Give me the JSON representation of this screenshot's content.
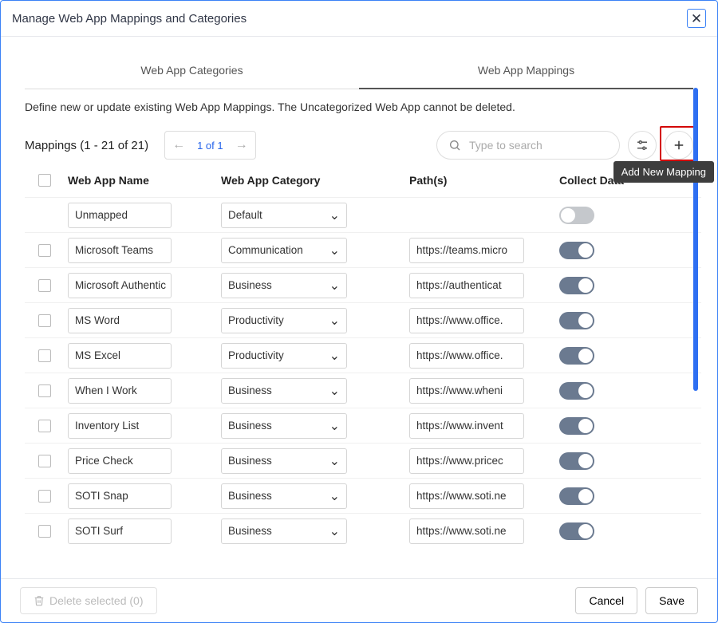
{
  "dialog": {
    "title": "Manage Web App Mappings and Categories",
    "tabs": {
      "categories": "Web App Categories",
      "mappings": "Web App Mappings"
    },
    "description": "Define new or update existing Web App Mappings. The Uncategorized Web App cannot be deleted.",
    "tooltip": "Add New Mapping"
  },
  "toolbar": {
    "count_label": "Mappings (1 - 21 of 21)",
    "page_text": "1 of 1",
    "search_placeholder": "Type to search"
  },
  "columns": {
    "name": "Web App Name",
    "category": "Web App Category",
    "paths": "Path(s)",
    "collect": "Collect Data"
  },
  "rows": [
    {
      "name": "Unmapped",
      "category": "Default",
      "path": "",
      "collect": false,
      "checkable": false
    },
    {
      "name": "Microsoft Teams",
      "category": "Communication",
      "path": "https://teams.micro",
      "collect": true,
      "checkable": true
    },
    {
      "name": "Microsoft Authentic",
      "category": "Business",
      "path": "https://authenticat",
      "collect": true,
      "checkable": true
    },
    {
      "name": "MS Word",
      "category": "Productivity",
      "path": "https://www.office.",
      "collect": true,
      "checkable": true
    },
    {
      "name": "MS Excel",
      "category": "Productivity",
      "path": "https://www.office.",
      "collect": true,
      "checkable": true
    },
    {
      "name": "When I Work",
      "category": "Business",
      "path": "https://www.wheni",
      "collect": true,
      "checkable": true
    },
    {
      "name": "Inventory List",
      "category": "Business",
      "path": "https://www.invent",
      "collect": true,
      "checkable": true
    },
    {
      "name": "Price Check",
      "category": "Business",
      "path": "https://www.pricec",
      "collect": true,
      "checkable": true
    },
    {
      "name": "SOTI Snap",
      "category": "Business",
      "path": "https://www.soti.ne",
      "collect": true,
      "checkable": true
    },
    {
      "name": "SOTI Surf",
      "category": "Business",
      "path": "https://www.soti.ne",
      "collect": true,
      "checkable": true
    }
  ],
  "footer": {
    "delete": "Delete selected (0)",
    "cancel": "Cancel",
    "save": "Save"
  }
}
